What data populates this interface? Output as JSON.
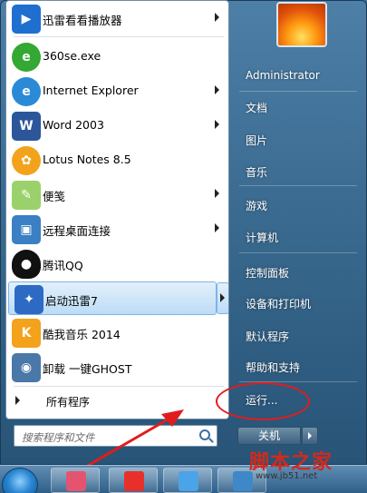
{
  "programs": [
    {
      "label": "迅雷看看播放器",
      "icon": "xunlei-kankan-icon",
      "color": "#1f6fd1",
      "has_submenu": true
    },
    {
      "label": "360se.exe",
      "icon": "360se-icon",
      "color": "#33a832",
      "has_submenu": false
    },
    {
      "label": "Internet Explorer",
      "icon": "ie-icon",
      "color": "#2a8ad8",
      "has_submenu": true
    },
    {
      "label": "Word 2003",
      "icon": "word-icon",
      "color": "#2b579a",
      "has_submenu": true
    },
    {
      "label": "Lotus Notes 8.5",
      "icon": "lotus-notes-icon",
      "color": "#f2a31b",
      "has_submenu": false
    },
    {
      "label": "便笺",
      "icon": "sticky-notes-icon",
      "color": "#9bd16a",
      "has_submenu": true
    },
    {
      "label": "远程桌面连接",
      "icon": "remote-desktop-icon",
      "color": "#3b7fc4",
      "has_submenu": true
    },
    {
      "label": "腾讯QQ",
      "icon": "qq-penguin-icon",
      "color": "#111111",
      "has_submenu": false
    },
    {
      "label": "启动迅雷7",
      "icon": "xunlei7-icon",
      "color": "#2c6ac4",
      "has_submenu": true
    },
    {
      "label": "酷我音乐 2014",
      "icon": "kuwo-music-icon",
      "color": "#f4a11c",
      "has_submenu": false
    },
    {
      "label": "卸载 一键GHOST",
      "icon": "ghost-uninstall-icon",
      "color": "#4a78a8",
      "has_submenu": false
    }
  ],
  "all_programs_label": "所有程序",
  "search": {
    "placeholder": "搜索程序和文件"
  },
  "right_links": [
    {
      "label": "Administrator"
    },
    {
      "label": "文档"
    },
    {
      "label": "图片"
    },
    {
      "label": "音乐"
    },
    {
      "label": "游戏"
    },
    {
      "label": "计算机"
    },
    {
      "label": "控制面板"
    },
    {
      "label": "设备和打印机"
    },
    {
      "label": "默认程序"
    },
    {
      "label": "帮助和支持"
    },
    {
      "label": "运行..."
    }
  ],
  "shutdown_label": "关机",
  "watermark": {
    "text": "脚本之家",
    "url": "www.jb51.net"
  },
  "colors": {
    "annotation": "#e21c1c",
    "highlight": "#bcdcf6"
  }
}
